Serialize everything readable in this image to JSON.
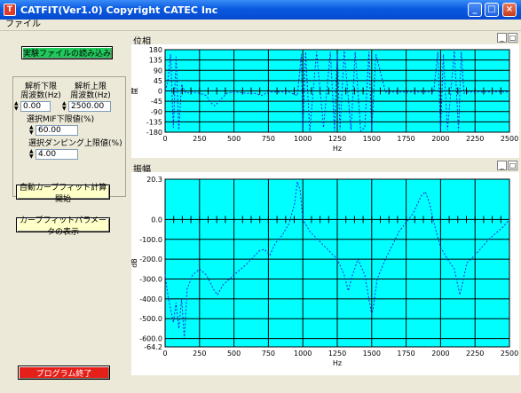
{
  "window": {
    "title": "CATFIT(Ver1.0) Copyright CATEC Inc"
  },
  "menu": {
    "file": "ファイル"
  },
  "left": {
    "load_button": "実験ファイルの読み込み",
    "lower_freq_label": "解析下限\n周波数(Hz)",
    "upper_freq_label": "解析上限\n周波数(Hz)",
    "lower_freq_value": "0.00",
    "upper_freq_value": "2500.00",
    "mif_label": "選択MIF下限値(%)",
    "mif_value": "60.00",
    "damping_label": "選択ダンピング上限値(%)",
    "damping_value": "4.00",
    "auto_fit_button": "自動カーブフィット計算開始",
    "show_params_button": "カーブフィットパラメータの表示",
    "exit_button": "プログラム終了"
  },
  "phase_panel": {
    "title": "位相"
  },
  "amp_panel": {
    "title": "振幅"
  },
  "chart_data": [
    {
      "type": "line",
      "title": "位相",
      "xlabel": "Hz",
      "ylabel": "度",
      "xlim": [
        0,
        2500
      ],
      "ylim": [
        -180,
        180
      ],
      "xticks": [
        0,
        250,
        500,
        750,
        1000,
        1250,
        1500,
        1750,
        2000,
        2250,
        2500
      ],
      "yticks": [
        180,
        135,
        90,
        45,
        0,
        -45,
        -90,
        -135,
        -180
      ],
      "grid": true,
      "background": "#00ffff",
      "line_color": "#2020e0",
      "series": [
        {
          "x": [
            0,
            20,
            40,
            60,
            80,
            100,
            120,
            150,
            200,
            250,
            300,
            330,
            360,
            400,
            450,
            500,
            600,
            650,
            700,
            750,
            800,
            900,
            960,
            990,
            1000,
            1020,
            1050,
            1100,
            1150,
            1200,
            1230,
            1250,
            1270,
            1300,
            1350,
            1380,
            1420,
            1450,
            1480,
            1500,
            1530,
            1600,
            1700,
            1800,
            1900,
            1950,
            1980,
            2000,
            2020,
            2050,
            2100,
            2130,
            2150,
            2170,
            2200,
            2300,
            2400,
            2500
          ],
          "values": [
            0,
            40,
            160,
            -160,
            150,
            -170,
            30,
            -10,
            -5,
            -10,
            -20,
            -50,
            -65,
            -40,
            -10,
            -5,
            -10,
            -10,
            -20,
            -5,
            -5,
            -5,
            -20,
            160,
            -170,
            170,
            -175,
            170,
            -160,
            170,
            -175,
            160,
            -170,
            175,
            -170,
            170,
            -175,
            -160,
            170,
            -175,
            160,
            -5,
            -5,
            -5,
            -5,
            -5,
            170,
            -175,
            160,
            -170,
            175,
            -175,
            170,
            -10,
            -5,
            -5,
            -5,
            -5
          ]
        }
      ]
    },
    {
      "type": "line",
      "title": "振幅",
      "xlabel": "Hz",
      "ylabel": "dB",
      "xlim": [
        0,
        2500
      ],
      "ylim": [
        -64.2,
        20.3
      ],
      "xticks": [
        0,
        250,
        500,
        750,
        1000,
        1250,
        1500,
        1750,
        2000,
        2250,
        2500
      ],
      "yticks": [
        20.3,
        0.0,
        -10.0,
        -20.0,
        -30.0,
        -40.0,
        -50.0,
        -60.0,
        -64.2
      ],
      "ytick_labels": [
        "20.3",
        "0.0",
        "-100.0",
        "-200.0",
        "-300.0",
        "-400.0",
        "-500.0",
        "-600.0",
        "-64.2"
      ],
      "grid": true,
      "background": "#00ffff",
      "line_color": "#2020e0",
      "series": [
        {
          "x": [
            0,
            20,
            40,
            60,
            80,
            100,
            120,
            140,
            160,
            200,
            250,
            300,
            350,
            380,
            420,
            500,
            600,
            680,
            720,
            760,
            800,
            850,
            900,
            940,
            960,
            980,
            1000,
            1050,
            1150,
            1250,
            1300,
            1330,
            1360,
            1400,
            1450,
            1500,
            1510,
            1540,
            1600,
            1700,
            1800,
            1860,
            1890,
            1920,
            1960,
            2000,
            2050,
            2100,
            2140,
            2160,
            2190,
            2250,
            2350,
            2450,
            2500
          ],
          "values": [
            -28,
            -38,
            -45,
            -52,
            -42,
            -55,
            -40,
            -60,
            -35,
            -28,
            -25,
            -28,
            -35,
            -38,
            -33,
            -28,
            -22,
            -16,
            -15,
            -18,
            -12,
            -8,
            -2,
            8,
            19,
            15,
            0,
            -6,
            -13,
            -20,
            -28,
            -36,
            -28,
            -20,
            -28,
            -48,
            -45,
            -30,
            -20,
            -6,
            3,
            12,
            14,
            8,
            -4,
            -14,
            -20,
            -25,
            -38,
            -32,
            -22,
            -18,
            -10,
            -4,
            0
          ]
        }
      ]
    }
  ]
}
